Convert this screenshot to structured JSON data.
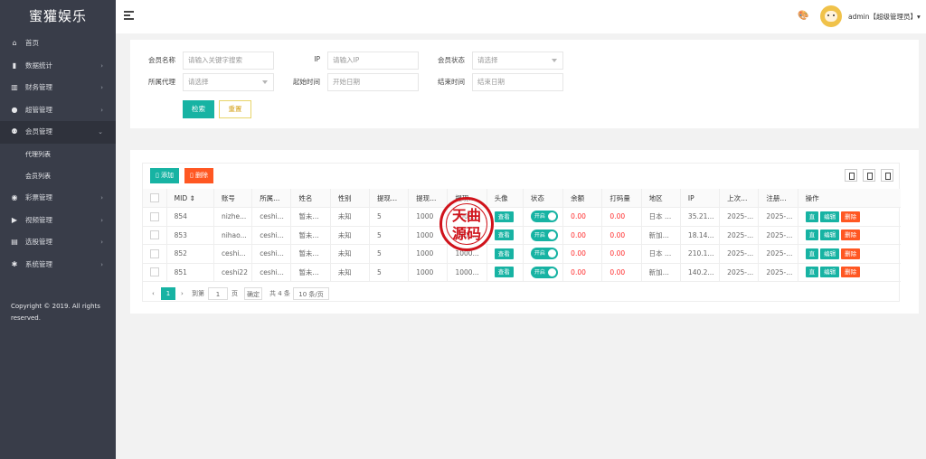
{
  "sidebar": {
    "logo": "蜜獾娱乐",
    "items": [
      {
        "label": "首页",
        "icon": "home-icon",
        "glyph": "⌂",
        "arrow": ""
      },
      {
        "label": "数据统计",
        "icon": "bar-chart-icon",
        "glyph": "▮",
        "arrow": "›"
      },
      {
        "label": "财务管理",
        "icon": "bank-icon",
        "glyph": "▥",
        "arrow": "›"
      },
      {
        "label": "超管管理",
        "icon": "user-icon",
        "glyph": "●",
        "arrow": "›"
      },
      {
        "label": "会员管理",
        "icon": "users-icon",
        "glyph": "⚉",
        "arrow": "⌄"
      }
    ],
    "sub_items": [
      "代理列表",
      "会员列表"
    ],
    "items_after": [
      {
        "label": "彩票管理",
        "icon": "gamepad-icon",
        "glyph": "◉",
        "arrow": "›"
      },
      {
        "label": "视频管理",
        "icon": "video-icon",
        "glyph": "▶",
        "arrow": "›"
      },
      {
        "label": "选股管理",
        "icon": "ticket-icon",
        "glyph": "▤",
        "arrow": "›"
      },
      {
        "label": "系统管理",
        "icon": "settings-icon",
        "glyph": "✱",
        "arrow": "›"
      }
    ],
    "copyright": "Copyright © 2019. All rights reserved."
  },
  "header": {
    "user": "admin【超级管理员】▾"
  },
  "search": {
    "member_name_label": "会员名称",
    "member_name_placeholder": "请输入关键字搜索",
    "ip_label": "IP",
    "ip_placeholder": "请输入IP",
    "status_label": "会员状态",
    "status_value": "请选择",
    "agent_label": "所属代理",
    "agent_value": "请选择",
    "start_label": "起始时间",
    "start_placeholder": "开始日期",
    "end_label": "结束时间",
    "end_placeholder": "结束日期",
    "search_button": "检索",
    "reset_button": "重置"
  },
  "table": {
    "add_button": "添加",
    "delete_button": "删除",
    "headers": [
      "MID ⇕",
      "账号",
      "所属...",
      "姓名",
      "性别",
      "提现...",
      "提现...",
      "提现...",
      "头像",
      "状态",
      "余额",
      "打码量",
      "地区",
      "IP",
      "上次...",
      "注册...",
      "操作"
    ],
    "view_label": "查看",
    "switch_label": "开启",
    "actions": [
      "直",
      "编辑",
      "删除"
    ],
    "rows": [
      {
        "mid": "854",
        "account": "nizhe...",
        "agent": "ceshi...",
        "name": "暂未...",
        "gender": "未知",
        "w1": "5",
        "w2": "1000",
        "w3": "1000...",
        "balance": "0.00",
        "code": "0.00",
        "region": "日本 ...",
        "ip": "35.21...",
        "last": "2025-...",
        "reg": "2025-..."
      },
      {
        "mid": "853",
        "account": "nihao...",
        "agent": "ceshi...",
        "name": "暂未...",
        "gender": "未知",
        "w1": "5",
        "w2": "1000",
        "w3": "1000...",
        "balance": "0.00",
        "code": "0.00",
        "region": "新加...",
        "ip": "18.14...",
        "last": "2025-...",
        "reg": "2025-..."
      },
      {
        "mid": "852",
        "account": "ceshi...",
        "agent": "ceshi...",
        "name": "暂未...",
        "gender": "未知",
        "w1": "5",
        "w2": "1000",
        "w3": "1000...",
        "balance": "0.00",
        "code": "0.00",
        "region": "日本 ...",
        "ip": "210.1...",
        "last": "2025-...",
        "reg": "2025-..."
      },
      {
        "mid": "851",
        "account": "ceshi22",
        "agent": "ceshi...",
        "name": "暂未...",
        "gender": "未知",
        "w1": "5",
        "w2": "1000",
        "w3": "1000...",
        "balance": "0.00",
        "code": "0.00",
        "region": "新加...",
        "ip": "140.2...",
        "last": "2025-...",
        "reg": "2025-..."
      }
    ]
  },
  "pager": {
    "current": "1",
    "goto_label": "到第",
    "page_input": "1",
    "page_unit": "页",
    "confirm": "确定",
    "total": "共 4 条",
    "page_size": "10 条/页"
  },
  "watermark": "天曲源码",
  "colors": {
    "accent": "#17b3a3",
    "danger": "#ff5722",
    "sidebar": "#393d49"
  }
}
